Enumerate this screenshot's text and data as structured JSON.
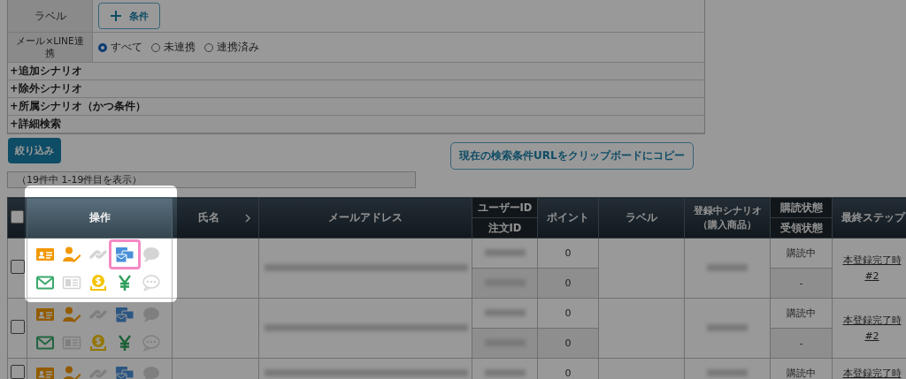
{
  "filter": {
    "label_row": {
      "label": "ラベル",
      "button": "条件"
    },
    "link_row": {
      "label": "メール×LINE連携",
      "options": [
        {
          "label": "すべて",
          "selected": true
        },
        {
          "label": "未連携",
          "selected": false
        },
        {
          "label": "連携済み",
          "selected": false
        }
      ]
    },
    "sections": [
      "+追加シナリオ",
      "+除外シナリオ",
      "+所属シナリオ（かつ条件）",
      "+詳細検索"
    ]
  },
  "filter_button": "絞り込み",
  "copy_button": "現在の検索条件URLをクリップボードにコピー",
  "result_count": "（19件中 1-19件目を表示）",
  "table": {
    "header_checked": false,
    "columns": {
      "actions": "操作",
      "name": "氏名",
      "email": "メールアドレス",
      "user_id": "ユーザーID",
      "order_id": "注文ID",
      "points": "ポイント",
      "label": "ラベル",
      "scenario": "登録中シナリオ（購入商品）",
      "subscription": "購読状態",
      "receipt": "受領状態",
      "last_step": "最終ステップ"
    },
    "rows": [
      {
        "checked": false,
        "points": [
          "0",
          "0"
        ],
        "subscription": "購読中",
        "receipt": "-",
        "last_step": [
          "本登録完了時",
          "#2"
        ],
        "actions": [
          {
            "kind": "card",
            "disabled": false,
            "highlighted": false
          },
          {
            "kind": "user-edit",
            "disabled": false,
            "highlighted": false
          },
          {
            "kind": "link",
            "disabled": true,
            "highlighted": false
          },
          {
            "kind": "mails",
            "disabled": false,
            "highlighted": true
          },
          {
            "kind": "bubble",
            "disabled": true,
            "highlighted": false
          },
          {
            "kind": "mail",
            "disabled": false,
            "highlighted": false
          },
          {
            "kind": "news",
            "disabled": true,
            "highlighted": false
          },
          {
            "kind": "coin",
            "disabled": false,
            "highlighted": false
          },
          {
            "kind": "yen",
            "disabled": false,
            "highlighted": false
          },
          {
            "kind": "chat",
            "disabled": true,
            "highlighted": false
          }
        ]
      },
      {
        "checked": false,
        "points": [
          "0",
          "0"
        ],
        "subscription": "購読中",
        "receipt": "-",
        "last_step": [
          "本登録完了時",
          "#2"
        ],
        "actions": [
          {
            "kind": "card",
            "disabled": false,
            "highlighted": false
          },
          {
            "kind": "user-edit",
            "disabled": false,
            "highlighted": false
          },
          {
            "kind": "link",
            "disabled": true,
            "highlighted": false
          },
          {
            "kind": "mails",
            "disabled": false,
            "highlighted": false
          },
          {
            "kind": "bubble",
            "disabled": true,
            "highlighted": false
          },
          {
            "kind": "mail",
            "disabled": false,
            "highlighted": false
          },
          {
            "kind": "news",
            "disabled": true,
            "highlighted": false
          },
          {
            "kind": "coin",
            "disabled": false,
            "highlighted": false
          },
          {
            "kind": "yen",
            "disabled": false,
            "highlighted": false
          },
          {
            "kind": "chat",
            "disabled": true,
            "highlighted": false
          }
        ]
      },
      {
        "checked": false,
        "points": [
          "0"
        ],
        "subscription": "購読中",
        "last_step": [
          "本登録完了時"
        ],
        "actions": [
          {
            "kind": "card",
            "disabled": false,
            "highlighted": false
          },
          {
            "kind": "user-edit",
            "disabled": false,
            "highlighted": false
          },
          {
            "kind": "link",
            "disabled": true,
            "highlighted": false
          },
          {
            "kind": "mails",
            "disabled": false,
            "highlighted": false
          },
          {
            "kind": "bubble",
            "disabled": true,
            "highlighted": false
          }
        ]
      }
    ]
  },
  "overlay": {
    "dimmed": true
  }
}
